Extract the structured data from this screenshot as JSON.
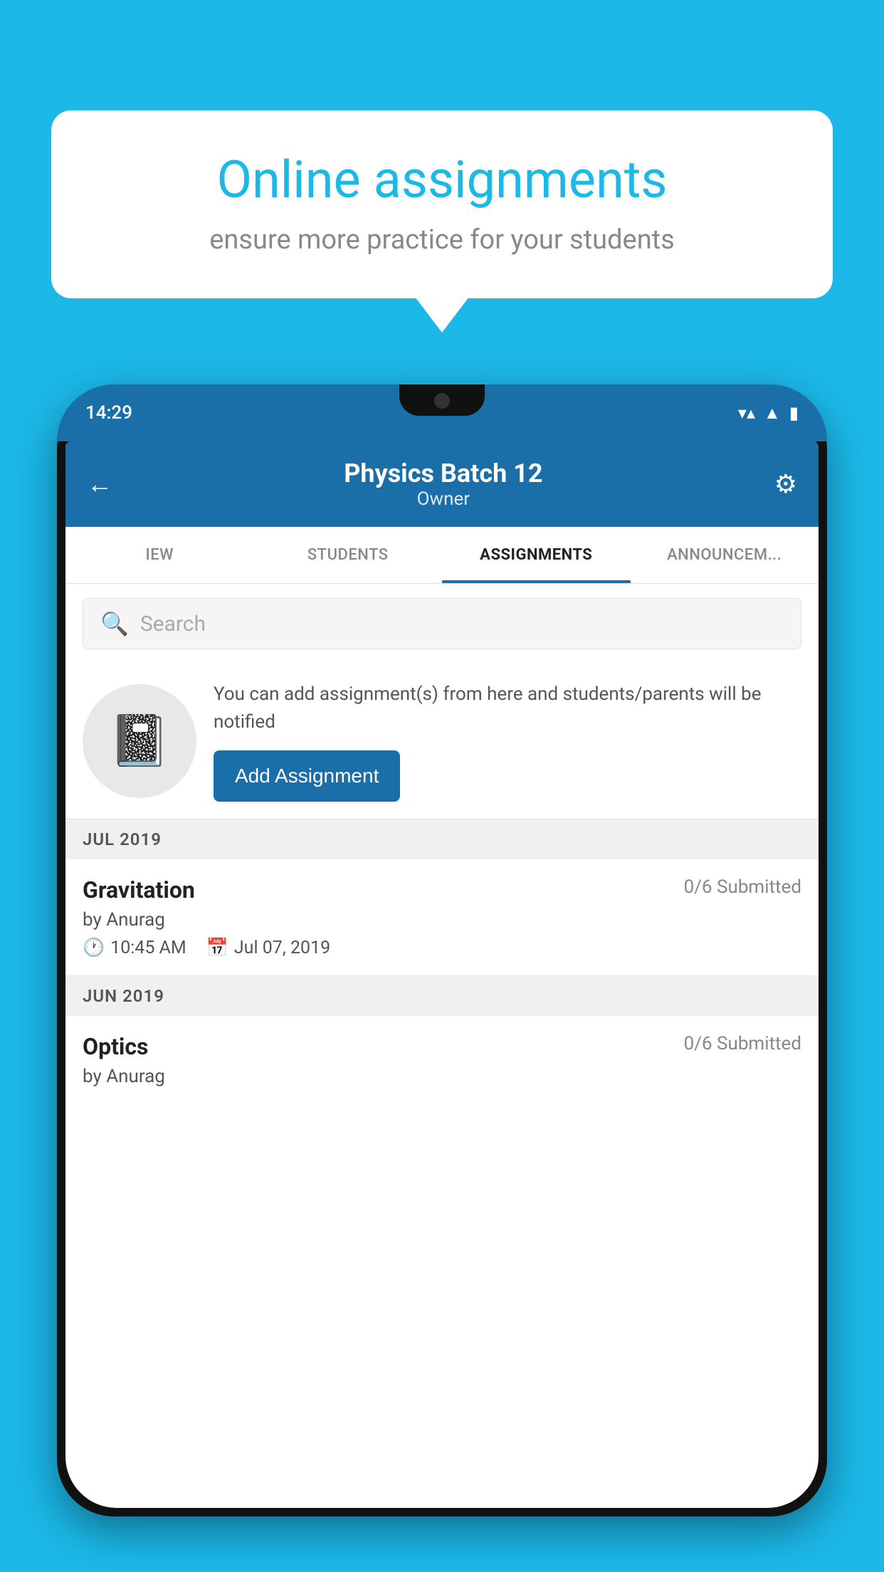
{
  "background_color": "#1bb8e8",
  "speech_bubble": {
    "title": "Online assignments",
    "subtitle": "ensure more practice for your students"
  },
  "phone": {
    "status_bar": {
      "time": "14:29",
      "wifi": "▼▲",
      "signal": "▲",
      "battery": "▌"
    },
    "header": {
      "title": "Physics Batch 12",
      "subtitle": "Owner",
      "back_label": "←",
      "settings_label": "⚙"
    },
    "tabs": [
      {
        "label": "IEW",
        "active": false
      },
      {
        "label": "STUDENTS",
        "active": false
      },
      {
        "label": "ASSIGNMENTS",
        "active": true
      },
      {
        "label": "ANNOUNCEM...",
        "active": false
      }
    ],
    "search": {
      "placeholder": "Search"
    },
    "promo": {
      "description": "You can add assignment(s) from here and students/parents will be notified",
      "button_label": "Add Assignment"
    },
    "sections": [
      {
        "month_label": "JUL 2019",
        "assignments": [
          {
            "name": "Gravitation",
            "submitted": "0/6 Submitted",
            "author": "by Anurag",
            "time": "10:45 AM",
            "date": "Jul 07, 2019"
          }
        ]
      },
      {
        "month_label": "JUN 2019",
        "assignments": [
          {
            "name": "Optics",
            "submitted": "0/6 Submitted",
            "author": "by Anurag",
            "time": "",
            "date": ""
          }
        ]
      }
    ]
  }
}
